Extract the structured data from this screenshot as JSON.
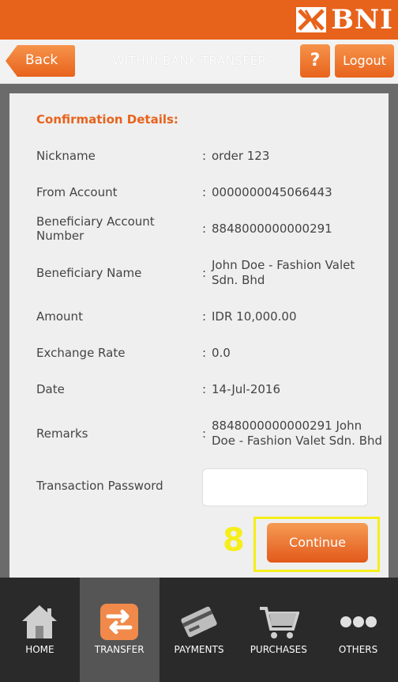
{
  "brand": {
    "name": "BNI"
  },
  "header": {
    "back_label": "Back",
    "title": "WITHIN BANK TRANSFER",
    "help_label": "?",
    "logout_label": "Logout"
  },
  "confirmation": {
    "title": "Confirmation Details:",
    "rows": [
      {
        "label": "Nickname",
        "value": "order 123"
      },
      {
        "label": "From Account",
        "value": "0000000045066443"
      },
      {
        "label": "Beneficiary Account Number",
        "value": "8848000000000291"
      },
      {
        "label": "Beneficiary Name",
        "value": "John Doe - Fashion Valet Sdn. Bhd"
      },
      {
        "label": "Amount",
        "value": "IDR 10,000.00"
      },
      {
        "label": "Exchange Rate",
        "value": "0.0"
      },
      {
        "label": "Date",
        "value": "14-Jul-2016"
      },
      {
        "label": "Remarks",
        "value": "8848000000000291 John Doe - Fashion Valet Sdn. Bhd"
      }
    ],
    "colon": ":"
  },
  "password": {
    "label": "Transaction Password",
    "value": ""
  },
  "annotation": {
    "step": "8"
  },
  "actions": {
    "continue_label": "Continue"
  },
  "bottom_nav": [
    {
      "label": "HOME",
      "icon": "home-icon"
    },
    {
      "label": "TRANSFER",
      "icon": "transfer-icon",
      "active": true
    },
    {
      "label": "PAYMENTS",
      "icon": "payments-icon"
    },
    {
      "label": "PURCHASES",
      "icon": "cart-icon"
    },
    {
      "label": "OTHERS",
      "icon": "more-icon"
    }
  ],
  "colors": {
    "brand_orange": "#e7621b",
    "highlight_yellow": "#f5ee1a"
  }
}
